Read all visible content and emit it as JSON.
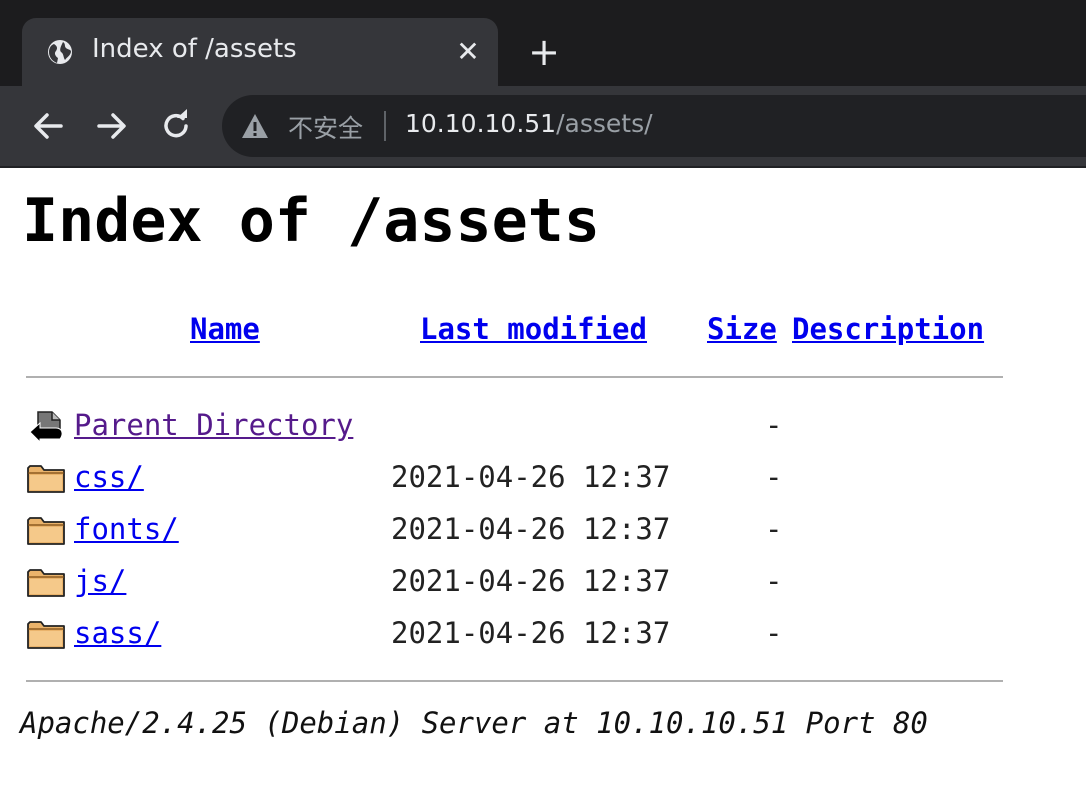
{
  "browser": {
    "tab": {
      "title": "Index of /assets",
      "close_label": "✕"
    },
    "new_tab_label": "+",
    "address_bar": {
      "security_label": "不安全",
      "url_host": "10.10.10.51",
      "url_path": "/assets/"
    }
  },
  "page": {
    "heading": "Index of /assets",
    "columns": {
      "name": "Name",
      "last_modified": "Last modified",
      "size": "Size",
      "description": "Description"
    },
    "rows": [
      {
        "icon": "parent-directory-icon",
        "name": "Parent Directory",
        "modified": "",
        "size": "-"
      },
      {
        "icon": "folder-icon",
        "name": "css/",
        "modified": "2021-04-26 12:37",
        "size": "-"
      },
      {
        "icon": "folder-icon",
        "name": "fonts/",
        "modified": "2021-04-26 12:37",
        "size": "-"
      },
      {
        "icon": "folder-icon",
        "name": "js/",
        "modified": "2021-04-26 12:37",
        "size": "-"
      },
      {
        "icon": "folder-icon",
        "name": "sass/",
        "modified": "2021-04-26 12:37",
        "size": "-"
      }
    ],
    "server_signature": "Apache/2.4.25 (Debian) Server at 10.10.10.51 Port 80"
  },
  "colors": {
    "link": "#0000ee",
    "visited_link": "#551a8b",
    "chrome_dark": "#202124",
    "chrome_tab": "#35363a"
  }
}
